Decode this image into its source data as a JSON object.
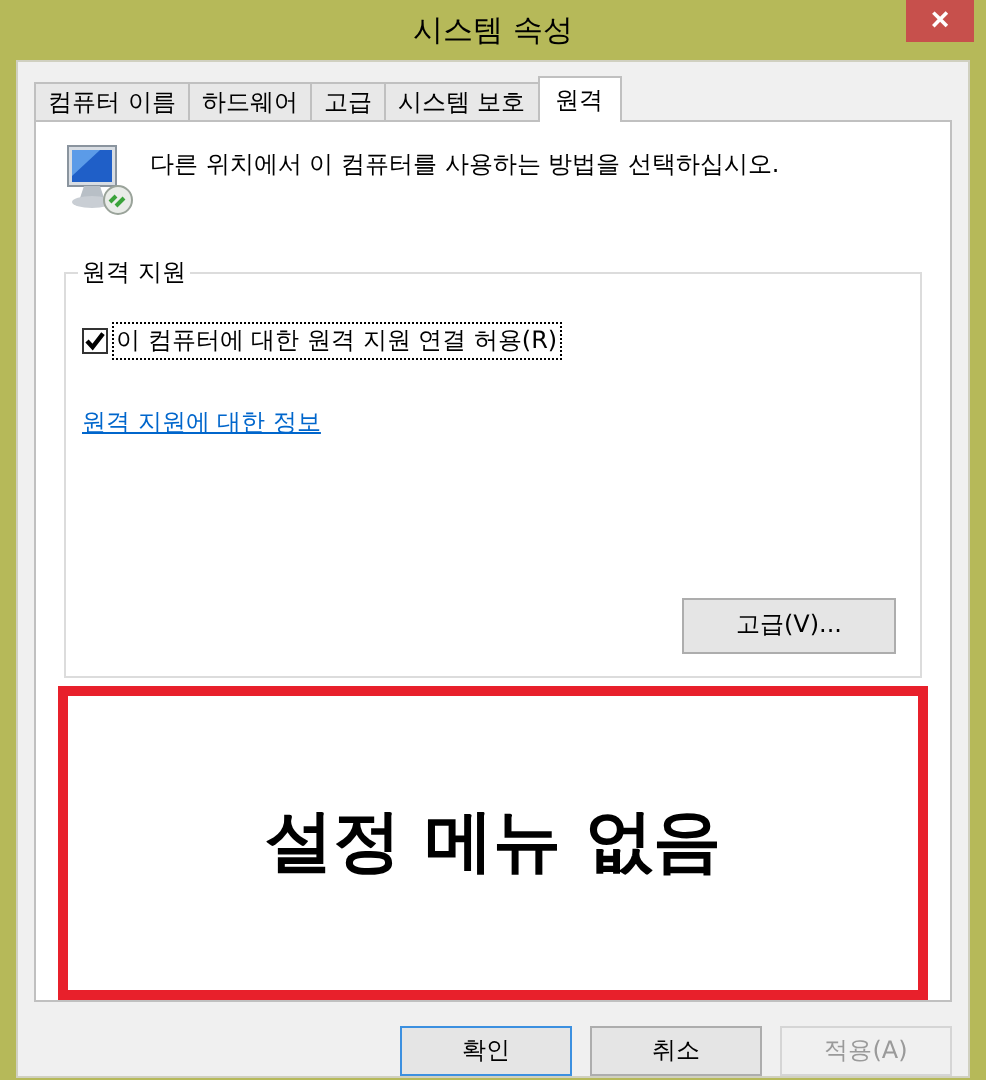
{
  "window": {
    "title": "시스템 속성",
    "close": "×"
  },
  "tabs": [
    {
      "label": "컴퓨터 이름",
      "selected": false
    },
    {
      "label": "하드웨어",
      "selected": false
    },
    {
      "label": "고급",
      "selected": false
    },
    {
      "label": "시스템 보호",
      "selected": false
    },
    {
      "label": "원격",
      "selected": true
    }
  ],
  "description": "다른 위치에서 이 컴퓨터를 사용하는 방법을 선택하십시오.",
  "group": {
    "title": "원격 지원",
    "checkbox": {
      "label": "이 컴퓨터에 대한 원격 지원 연결 허용(R)",
      "checked": true
    },
    "link": "원격 지원에 대한 정보",
    "button": "고급(V)..."
  },
  "annotation": {
    "text": "설정 메뉴 없음"
  },
  "buttons": [
    {
      "label": "확인",
      "kind": "default"
    },
    {
      "label": "취소",
      "kind": "normal"
    },
    {
      "label": "적용(A)",
      "kind": "disabled"
    }
  ]
}
